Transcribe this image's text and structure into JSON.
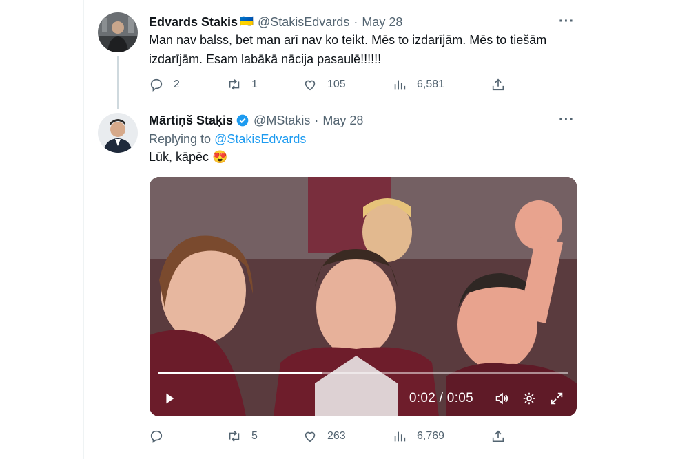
{
  "tweets": [
    {
      "author": "Edvards Stakis",
      "flag": "🇺🇦",
      "handle": "@StakisEdvards",
      "date": "May 28",
      "more": "···",
      "text": "Man nav balss, bet man arī nav ko teikt. Mēs to izdarījām. Mēs to tiešām izdarījām. Esam labākā nācija pasaulē!!!!!!",
      "replies": "2",
      "retweets": "1",
      "likes": "105",
      "views": "6,581"
    },
    {
      "author": "Mārtiņš Staķis",
      "handle": "@MStakis",
      "date": "May 28",
      "more": "···",
      "replying_prefix": "Replying to",
      "replying_handle": "@StakisEdvards",
      "text": "Lūk, kāpēc 😍",
      "video": {
        "time": "0:02 / 0:05",
        "progress": 0.4
      },
      "replies": "",
      "retweets": "5",
      "likes": "263",
      "views": "6,769"
    }
  ],
  "colors": {
    "text": "#0f1419",
    "secondary": "#536471",
    "link": "#1d9bf0",
    "verified": "#1d9bf0"
  },
  "icons": [
    "reply-icon",
    "retweet-icon",
    "like-icon",
    "views-icon",
    "share-icon",
    "play-icon",
    "volume-icon",
    "settings-icon",
    "fullscreen-icon",
    "verified-icon",
    "more-icon"
  ]
}
